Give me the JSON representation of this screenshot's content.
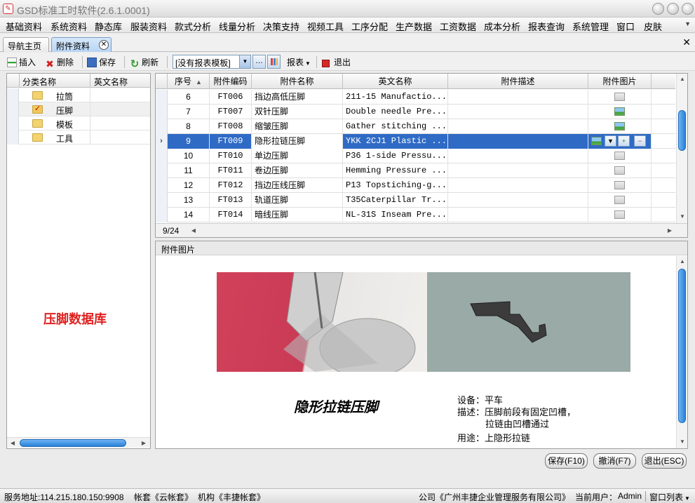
{
  "window": {
    "title": "GSD标准工时软件(2.6.1.0001)"
  },
  "menu": [
    "基础资料",
    "系统资料",
    "静态库",
    "服装资料",
    "款式分析",
    "线量分析",
    "决策支持",
    "视频工具",
    "工序分配",
    "生产数据",
    "工资数据",
    "成本分析",
    "报表查询",
    "系统管理",
    "窗口",
    "皮肤"
  ],
  "tabs": [
    "导航主页",
    "附件资料"
  ],
  "toolbar": {
    "insert": "插入",
    "delete": "删除",
    "save": "保存",
    "refresh": "刷新",
    "template": "[没有报表模板]",
    "report": "报表",
    "exit": "退出"
  },
  "category_panel": {
    "headers": [
      "分类名称",
      "英文名称"
    ],
    "items": [
      {
        "name": "拉筒",
        "checked": false
      },
      {
        "name": "压脚",
        "checked": true
      },
      {
        "name": "模板",
        "checked": false
      },
      {
        "name": "工具",
        "checked": false
      }
    ],
    "label": "压脚数据库"
  },
  "grid": {
    "headers": [
      "序号",
      "附件编码",
      "附件名称",
      "英文名称",
      "附件描述",
      "附件图片"
    ],
    "rows": [
      {
        "no": "6",
        "code": "FT006",
        "name": "挡边高低压脚",
        "en": "211-15 Manufactio...",
        "pic": "gray"
      },
      {
        "no": "7",
        "code": "FT007",
        "name": "双针压脚",
        "en": "Double needle Pre...",
        "pic": "color"
      },
      {
        "no": "8",
        "code": "FT008",
        "name": "缩皱压脚",
        "en": "Gather stitching ...",
        "pic": "color"
      },
      {
        "no": "9",
        "code": "FT009",
        "name": "隐形拉链压脚",
        "en": "YKK 2CJ1 Plastic ...",
        "pic": "color"
      },
      {
        "no": "10",
        "code": "FT010",
        "name": "单边压脚",
        "en": "P36 1-side Pressu...",
        "pic": "gray"
      },
      {
        "no": "11",
        "code": "FT011",
        "name": "卷边压脚",
        "en": "Hemming Pressure ...",
        "pic": "gray"
      },
      {
        "no": "12",
        "code": "FT012",
        "name": "挡边压线压脚",
        "en": "P13 Topstiching-g...",
        "pic": "gray"
      },
      {
        "no": "13",
        "code": "FT013",
        "name": "轨道压脚",
        "en": "T35Caterpillar Tr...",
        "pic": "gray"
      },
      {
        "no": "14",
        "code": "FT014",
        "name": "暗线压脚",
        "en": "NL-31S Inseam Pre...",
        "pic": "gray"
      }
    ],
    "record_count": "9/24"
  },
  "image_panel": {
    "header": "附件图片",
    "caption_title": "隐形拉链压脚",
    "lines": [
      "设备：平车",
      "描述：压脚前段有固定凹槽，",
      "拉链由凹槽通过",
      "用途：上隐形拉链"
    ]
  },
  "buttons": {
    "save": "保存(F10)",
    "cancel": "撤消(F7)",
    "exit": "退出(ESC)"
  },
  "status": {
    "server": "服务地址:114.215.180.150:9908",
    "account": "帐套《云帐套》",
    "org": "机构《丰捷帐套》",
    "company": "公司《广州丰捷企业管理服务有限公司》",
    "user_label": "当前用户：",
    "user": "Admin",
    "window_list": "窗口列表"
  },
  "colors": {
    "selection": "#2f6bc5",
    "db_label": "#e0201f"
  }
}
